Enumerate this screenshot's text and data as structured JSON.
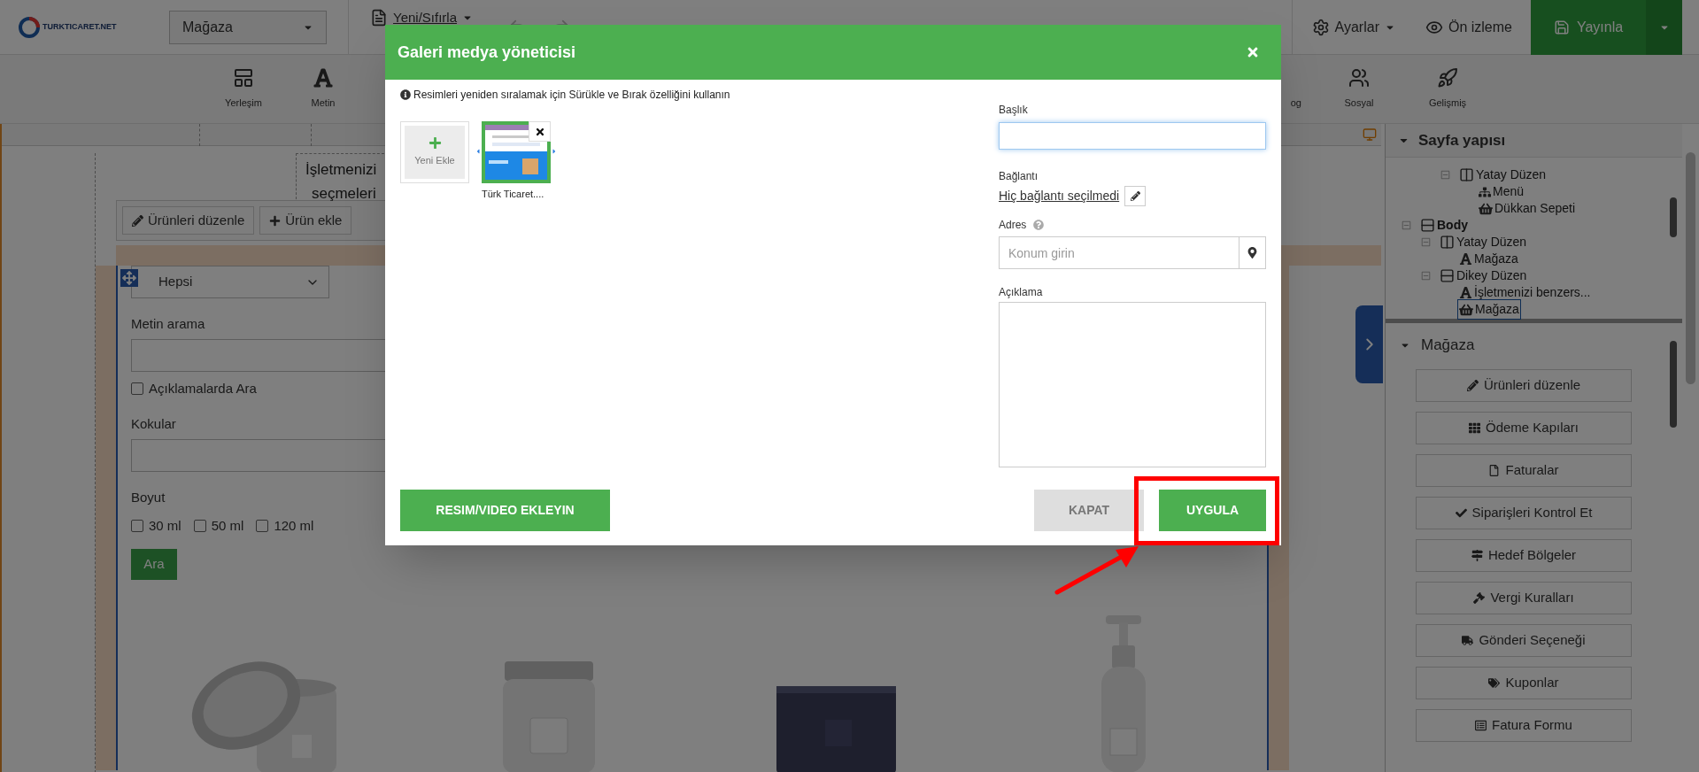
{
  "topbar": {
    "logo_text": "TURKTICARET.NET",
    "page_select": "Mağaza",
    "reset_menu": "Yeni/Sıfırla",
    "settings_menu": "Ayarlar",
    "preview_button": "Ön izleme",
    "publish_button": "Yayınla"
  },
  "toolbar": {
    "tools": [
      {
        "label": "Yerleşim"
      },
      {
        "label": "Metin"
      },
      {
        "label": "og"
      },
      {
        "label": "Sosyal"
      },
      {
        "label": "Gelişmiş"
      }
    ]
  },
  "canvas": {
    "heading_lines": [
      "İşletmenizi",
      "seçmeleri"
    ],
    "widget_buttons": [
      "Ürünleri düzenle",
      "Ürün ekle"
    ],
    "filter": {
      "category_select": "Hepsi",
      "text_search_label": "Metin arama",
      "search_in_descriptions": {
        "label": "Açıklamalarda Ara",
        "checked": false
      },
      "scents_label": "Kokular",
      "size_label": "Boyut",
      "size_options": [
        {
          "label": "30 ml",
          "checked": false
        },
        {
          "label": "50 ml",
          "checked": false
        },
        {
          "label": "120 ml",
          "checked": false
        }
      ],
      "search_button": "Ara"
    },
    "products": [
      {
        "kind": "picture"
      },
      {
        "kind": "picture"
      },
      {
        "kind": "picture"
      },
      {
        "kind": "picture"
      }
    ]
  },
  "sidebar": {
    "structure_title": "Sayfa yapısı",
    "tree": [
      {
        "label": "Yatay Düzen",
        "kind": "columns",
        "expanded": true,
        "selected": false,
        "children": [
          {
            "label": "Menü",
            "kind": "menu",
            "selected": false
          },
          {
            "label": "Dükkan Sepeti",
            "kind": "cart",
            "selected": false
          }
        ]
      },
      {
        "label": "Body",
        "kind": "rows",
        "expanded": true,
        "selected": false,
        "children": [
          {
            "label": "Yatay Düzen",
            "kind": "columns",
            "expanded": true,
            "selected": false,
            "children": [
              {
                "label": "Mağaza",
                "kind": "text",
                "selected": false
              }
            ]
          },
          {
            "label": "Dikey Düzen",
            "kind": "rows",
            "expanded": true,
            "selected": false,
            "children": [
              {
                "label": "İşletmenizi benzers...",
                "kind": "text",
                "selected": false
              },
              {
                "label": "Mağaza",
                "kind": "store",
                "selected": true
              }
            ]
          }
        ]
      }
    ],
    "store_title": "Mağaza",
    "store_buttons": [
      "Ürünleri düzenle",
      "Ödeme Kapıları",
      "Faturalar",
      "Siparişleri Kontrol Et",
      "Hedef Bölgeler",
      "Vergi Kuralları",
      "Gönderi Seçeneği",
      "Kuponlar",
      "Fatura Formu"
    ]
  },
  "modal": {
    "title": "Galeri medya yöneticisi",
    "hint": "Resimleri yeniden sıralamak için Sürükle ve Bırak özelliğini kullanın",
    "items": [
      {
        "kind": "add",
        "label": "Yeni Ekle"
      },
      {
        "caption": "Türk Ticaret....",
        "selected": true
      }
    ],
    "add_media_button": "RESIM/VIDEO EKLEYIN",
    "title_field": {
      "label": "Başlık",
      "focused": true
    },
    "link_field": {
      "label": "Bağlantı",
      "value": "Hiç bağlantı seçilmedi"
    },
    "address_field": {
      "label": "Adres",
      "placeholder": "Konum girin"
    },
    "description_field": {
      "label": "Açıklama"
    },
    "close_button": "KAPAT",
    "apply_button": "UYGULA"
  }
}
